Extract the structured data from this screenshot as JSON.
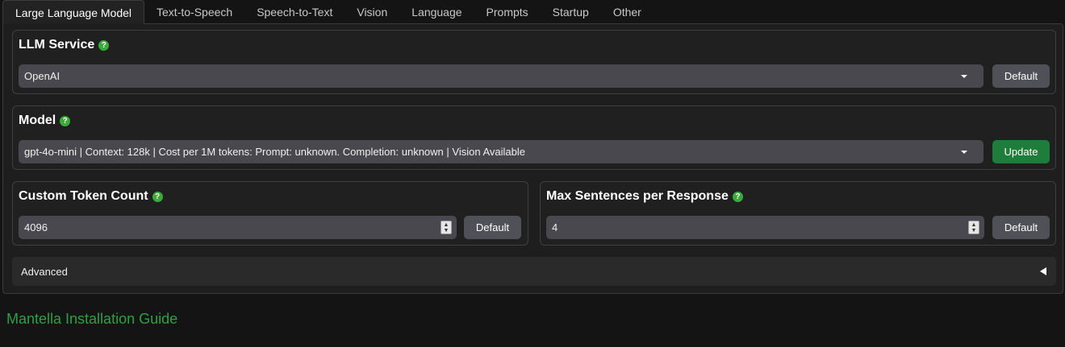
{
  "tabs": [
    {
      "label": "Large Language Model",
      "active": true
    },
    {
      "label": "Text-to-Speech"
    },
    {
      "label": "Speech-to-Text"
    },
    {
      "label": "Vision"
    },
    {
      "label": "Language"
    },
    {
      "label": "Prompts"
    },
    {
      "label": "Startup"
    },
    {
      "label": "Other"
    }
  ],
  "llm_service": {
    "title": "LLM Service",
    "help_icon": "?",
    "value": "OpenAI",
    "button_label": "Default"
  },
  "model": {
    "title": "Model",
    "help_icon": "?",
    "value": "gpt-4o-mini | Context: 128k | Cost per 1M tokens: Prompt: unknown. Completion: unknown | Vision Available",
    "button_label": "Update"
  },
  "custom_token_count": {
    "title": "Custom Token Count",
    "help_icon": "?",
    "value": "4096",
    "button_label": "Default"
  },
  "max_sentences": {
    "title": "Max Sentences per Response",
    "help_icon": "?",
    "value": "4",
    "button_label": "Default"
  },
  "advanced": {
    "label": "Advanced",
    "arrow": "◀"
  },
  "footer": {
    "link_text": "Mantella Installation Guide"
  },
  "colors": {
    "background": "#141414",
    "accent_green": "#2ea043",
    "update_button": "#1e7d3a",
    "help_icon": "#3aaa3a"
  }
}
